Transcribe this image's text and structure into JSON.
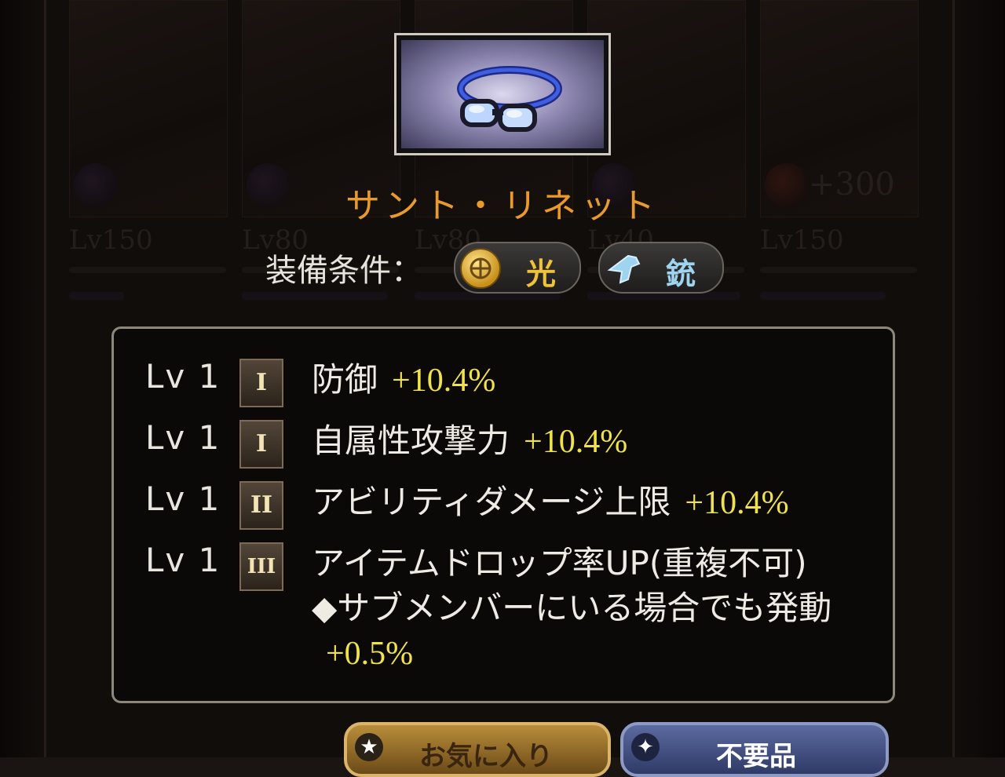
{
  "background": {
    "card_levels": [
      "Lv150",
      "Lv80",
      "Lv80",
      "Lv40",
      "Lv150"
    ],
    "card_bonus": "+300"
  },
  "item": {
    "name": "サント・リネット",
    "image": "goggles-icon"
  },
  "requirements": {
    "label": "装備条件：",
    "element": {
      "text": "光",
      "icon": "light-element-icon",
      "color": "#f0c23a"
    },
    "weapon": {
      "text": "銃",
      "icon": "gun-weapon-icon",
      "color": "#9fd4f0"
    }
  },
  "stats": [
    {
      "level": "Lv 1",
      "tier": "I",
      "name": "防御",
      "value": "+10.4%"
    },
    {
      "level": "Lv 1",
      "tier": "I",
      "name": "自属性攻撃力",
      "value": "+10.4%"
    },
    {
      "level": "Lv 1",
      "tier": "II",
      "name": "アビリティダメージ上限",
      "value": "+10.4%"
    },
    {
      "level": "Lv 1",
      "tier": "III",
      "name": "アイテムドロップ率UP(重複不可)　◆サブメンバーにいる場合でも発動",
      "value": "+0.5%"
    }
  ],
  "buttons": {
    "favorite": {
      "label": "お気に入り",
      "icon": "star-icon"
    },
    "junk": {
      "label": "不要品",
      "icon": "trash-icon"
    }
  },
  "colors": {
    "item_name": "#e89b2c",
    "stat_value": "#f0e24a",
    "panel_border": "#8e877c"
  }
}
